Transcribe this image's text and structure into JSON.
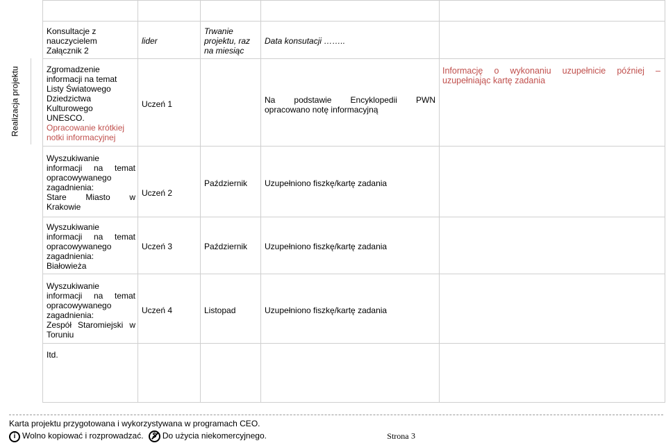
{
  "side_label": "Realizacja projektu",
  "header_row": {
    "topic_lines": [
      "Konsultacje z",
      "nauczycielem",
      "Załącznik 2"
    ],
    "who": "lider",
    "duration_lines": [
      "Trwanie",
      "projektu, raz",
      "na miesiąc"
    ],
    "result": "Data konsutacji ……..",
    "notes": ""
  },
  "rows": [
    {
      "topic_lines": [
        "Zgromadzenie",
        "informacji na temat",
        "Listy Światowego",
        "Dziedzictwa",
        "Kulturowego",
        "UNESCO."
      ],
      "topic_extra_lines": [
        "Opracowanie krótkiej",
        "notki informacyjnej"
      ],
      "who": "Uczeń 1",
      "month": "",
      "result_line1": [
        "Na",
        "podstawie",
        "Encyklopedii",
        "PWN"
      ],
      "result_line2": "opracowano notę informacyjną",
      "note_line1": "Informację o wykonaniu uzupełnicie później –",
      "note_line2": "uzupełniając kartę zadania"
    },
    {
      "topic_lines": [
        "Wyszukiwanie",
        "informacji na temat",
        "opracowywanego",
        "zagadnienia:"
      ],
      "topic_highlight_lines": [
        "Stare Miasto w",
        "Krakowie"
      ],
      "who": "Uczeń 2",
      "month": "Październik",
      "result": "Uzupełniono fiszkę/kartę zadania"
    },
    {
      "topic_lines": [
        "Wyszukiwanie",
        "informacji na temat",
        "opracowywanego",
        "zagadnienia:"
      ],
      "topic_highlight_lines": [
        "Białowieża"
      ],
      "who": "Uczeń 3",
      "month": "Październik",
      "result": "Uzupełniono fiszkę/kartę zadania"
    },
    {
      "topic_lines": [
        "Wyszukiwanie",
        "informacji na temat",
        "opracowywanego",
        "zagadnienia:"
      ],
      "topic_highlight_lines": [
        "Zespół Staromiejski w",
        "Toruniu"
      ],
      "who": "Uczeń 4",
      "month": "Listopad",
      "result": "Uzupełniono fiszkę/kartę zadania"
    }
  ],
  "etc_label": "Itd.",
  "footer": {
    "line1": "Karta projektu przygotowana i wykorzystywana w programach CEO.",
    "license_part1": "Wolno kopiować i rozprowadzać.",
    "license_part2": "Do użycia niekomercyjnego.",
    "page_label": "Strona",
    "page_number": "3"
  },
  "colors": {
    "highlight": "#c0504d",
    "grid": "#cfcfcf"
  }
}
